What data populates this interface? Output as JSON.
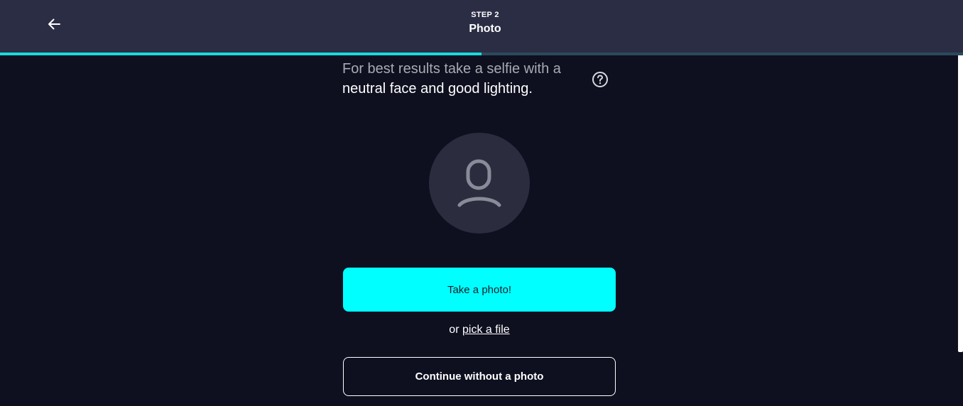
{
  "header": {
    "back_icon": "arrow-left-icon",
    "step_label": "STEP 2",
    "step_title": "Photo"
  },
  "progress": {
    "fraction": 0.5,
    "fill_color": "#19d9dc",
    "track_color": "#2c4a5c"
  },
  "instructions": {
    "muted_text": "For best results take a selfie with a",
    "strong_text": "neutral face and good lighting.",
    "help_icon": "question-circle-icon"
  },
  "avatar": {
    "icon": "user-placeholder-icon"
  },
  "actions": {
    "take_photo_label": "Take a photo!",
    "or_text": "or",
    "pick_file_label": "pick a file",
    "continue_label": "Continue without a photo"
  },
  "colors": {
    "background": "#0e1020",
    "header": "#2b2d45",
    "accent": "#00ffff"
  }
}
